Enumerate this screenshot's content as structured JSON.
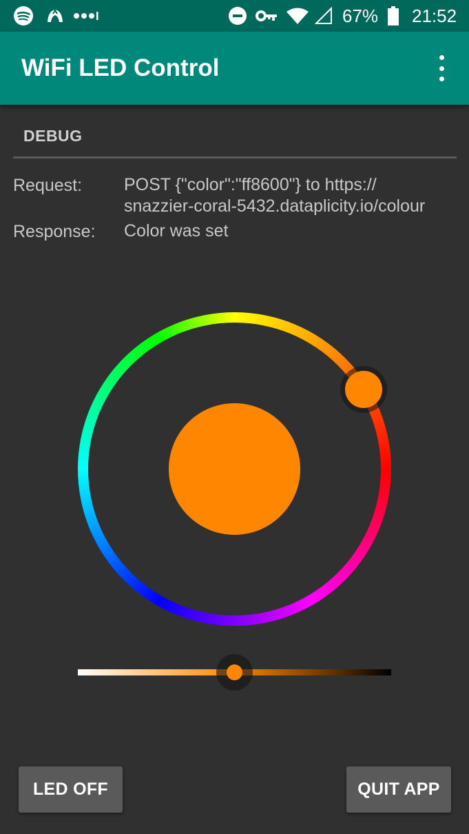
{
  "status_bar": {
    "battery_percent": "67%",
    "time": "21:52",
    "icons": [
      "spotify-icon",
      "notification-app-icon",
      "more-notifications-icon",
      "do-not-disturb-icon",
      "vpn-key-icon",
      "wifi-icon",
      "cellular-signal-icon",
      "battery-icon"
    ]
  },
  "app_bar": {
    "title": "WiFi LED Control",
    "menu_icon": "more-vert-icon"
  },
  "debug": {
    "section_title": "DEBUG",
    "request_label": "Request:",
    "request_value_line1": "POST {\"color\":\"ff8600\"} to https://",
    "request_value_line2": "snazzier-coral-5432.dataplicity.io/colour",
    "response_label": "Response:",
    "response_value": "Color was set"
  },
  "color_picker": {
    "selected_color": "#ff8600",
    "brightness_level": 0.5
  },
  "buttons": {
    "led_off": "LED OFF",
    "quit_app": "QUIT APP"
  },
  "colors": {
    "status_bar_bg": "#00695c",
    "app_bar_bg": "#00897b",
    "background": "#303030",
    "button_bg": "#5a5a5a",
    "selected": "#ff8600"
  }
}
